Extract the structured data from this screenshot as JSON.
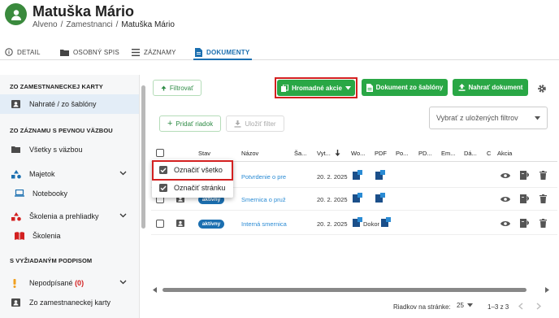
{
  "header": {
    "title": "Matuška Mário",
    "breadcrumbs": [
      "Alveno",
      "Zamestnanci",
      "Matuška Mário"
    ],
    "breadcrumb_separator": "/"
  },
  "tabs": [
    {
      "label": "DETAIL",
      "icon": "info-icon"
    },
    {
      "label": "OSOBNÝ SPIS",
      "icon": "folder-icon"
    },
    {
      "label": "ZÁZNAMY",
      "icon": "list-icon"
    },
    {
      "label": "DOKUMENTY",
      "icon": "document-icon",
      "active": true
    }
  ],
  "sidebar": {
    "sections": [
      {
        "title": "ZO ZAMESTNANECKEJ KARTY"
      },
      {
        "title": "ZO ZÁZNAMU S PEVNOU VÄZBOU"
      },
      {
        "title": "S VYŽIADANÝM PODPISOM"
      }
    ],
    "items": [
      {
        "label": "Nahraté / zo šablóny",
        "icon": "id-card-icon",
        "selected": true
      },
      {
        "label": "Všetky s väzbou",
        "icon": "folder-icon"
      },
      {
        "label": "Majetok",
        "icon": "shapes-icon",
        "expandable": true
      },
      {
        "label": "Notebooky",
        "icon": "laptop-icon"
      },
      {
        "label": "Školenia a prehliadky",
        "icon": "shapes-icon",
        "expandable": true
      },
      {
        "label": "Školenia",
        "icon": "book-icon"
      },
      {
        "label": "Nepodpísané",
        "count": "(0)",
        "icon": "exclamation-icon",
        "expandable": true
      },
      {
        "label": "Zo zamestnaneckej karty",
        "icon": "id-card-icon"
      }
    ]
  },
  "toolbar": {
    "filter_label": "Filtrovať",
    "bulk_actions_label": "Hromadné akcie",
    "template_doc_label": "Dokument zo šablóny",
    "upload_doc_label": "Nahrať dokument",
    "add_row_label": "Pridať riadok",
    "save_filter_label": "Uložiť filter",
    "saved_filters_placeholder": "Vybrať z uložených filtrov"
  },
  "table": {
    "columns": [
      "Stav",
      "Názov",
      "Ša...",
      "Vyt...",
      "Wo...",
      "PDF",
      "Po...",
      "PD...",
      "Em...",
      "Dá...",
      "C",
      "Akcia"
    ],
    "rows": [
      {
        "status": "",
        "name": "Potvrdenie o pre",
        "date": "20. 2. 2025",
        "pdf": ""
      },
      {
        "status": "aktívny",
        "name": "Smernica o pruž",
        "date": "20. 2. 2025",
        "pdf": ""
      },
      {
        "status": "aktívny",
        "name": "Interná smernica",
        "date": "20. 2. 2025",
        "pdf": "Dokon"
      }
    ]
  },
  "popup": {
    "items": [
      {
        "label": "Označiť všetko"
      },
      {
        "label": "Označiť stránku"
      }
    ]
  },
  "pagination": {
    "rows_per_page_label": "Riadkov na stránke:",
    "rows_per_page_value": "25",
    "range": "1–3 z 3"
  },
  "colors": {
    "primary_green": "#29a745",
    "accent_blue": "#1b6fb0",
    "highlight_red": "#d32020",
    "avatar_green": "#3a8a3d"
  }
}
